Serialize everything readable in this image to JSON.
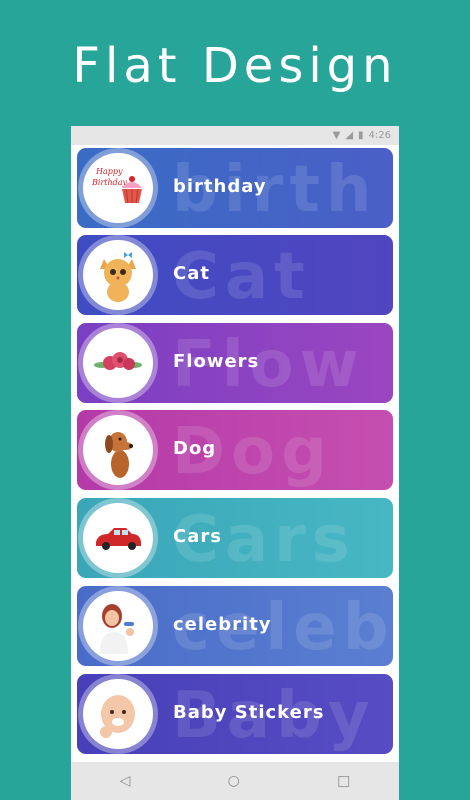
{
  "headline": "Flat Design",
  "status_bar": {
    "time": "4:26"
  },
  "categories": [
    {
      "label": "birthday",
      "ghost": "birth",
      "color_left": "#3a6cc4",
      "color_right": "#4a5fc7",
      "icon": "birthday-cupcake-icon",
      "icon_text": "Happy Birthday"
    },
    {
      "label": "Cat",
      "ghost": "Cat",
      "color_left": "#3f4cc2",
      "color_right": "#5145c0",
      "icon": "cat-icon"
    },
    {
      "label": "Flowers",
      "ghost": "Flow",
      "color_left": "#7a3fc2",
      "color_right": "#9b46c0",
      "icon": "flowers-icon"
    },
    {
      "label": "Dog",
      "ghost": "Dog",
      "color_left": "#b43aa8",
      "color_right": "#c54fb0",
      "icon": "dog-icon"
    },
    {
      "label": "Cars",
      "ghost": "Cars",
      "color_left": "#3aa6b8",
      "color_right": "#48b7c4",
      "icon": "car-icon"
    },
    {
      "label": "celebrity",
      "ghost": "celeb",
      "color_left": "#4a6cc8",
      "color_right": "#5a7fd1",
      "icon": "celebrity-icon"
    },
    {
      "label": "Baby Stickers",
      "ghost": "Baby",
      "color_left": "#4740b8",
      "color_right": "#574cc3",
      "icon": "baby-icon"
    }
  ],
  "nav": {
    "back": "◁",
    "home": "○",
    "recents": "□"
  }
}
